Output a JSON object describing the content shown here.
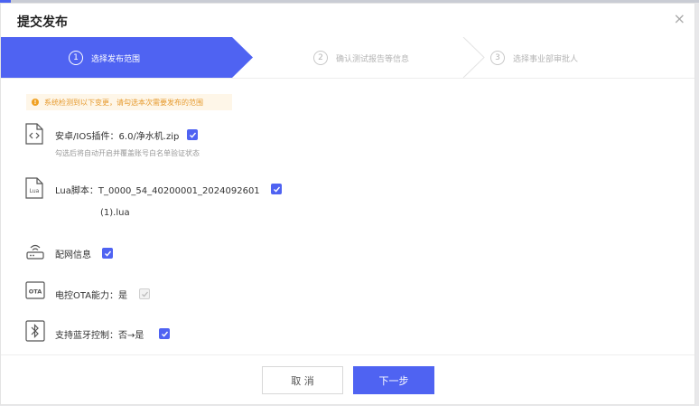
{
  "dialog": {
    "title": "提交发布",
    "close_icon": "×"
  },
  "steps": [
    {
      "num": "1",
      "label": "选择发布范围",
      "state": "active"
    },
    {
      "num": "2",
      "label": "确认测试报告等信息",
      "state": "inactive"
    },
    {
      "num": "3",
      "label": "选择事业部审批人",
      "state": "inactive"
    }
  ],
  "notice": {
    "icon": "!",
    "text": "系统检测到以下变更，请勾选本次需要发布的范围"
  },
  "items": {
    "plugin": {
      "label": "安卓/IOS插件：6.0/净水机.zip",
      "sub": "勾选后将自动开启并覆盖账号白名单验证状态",
      "checked": true
    },
    "lua": {
      "label": "Lua脚本：T_0000_54_40200001_2024092601",
      "label2": "(1).lua",
      "icon_text": "Lua",
      "checked": true
    },
    "network": {
      "label": "配网信息",
      "checked": true
    },
    "ota": {
      "label": "电控OTA能力：是",
      "icon_text": "OTA",
      "checked": true,
      "disabled": true
    },
    "bluetooth": {
      "label": "支持蓝牙控制：否→是",
      "checked": true
    }
  },
  "footer": {
    "cancel_label": "取 消",
    "next_label": "下一步"
  },
  "colors": {
    "primary": "#4f63f2",
    "warning": "#e69a2e",
    "notice_bg": "#fef6e8"
  }
}
